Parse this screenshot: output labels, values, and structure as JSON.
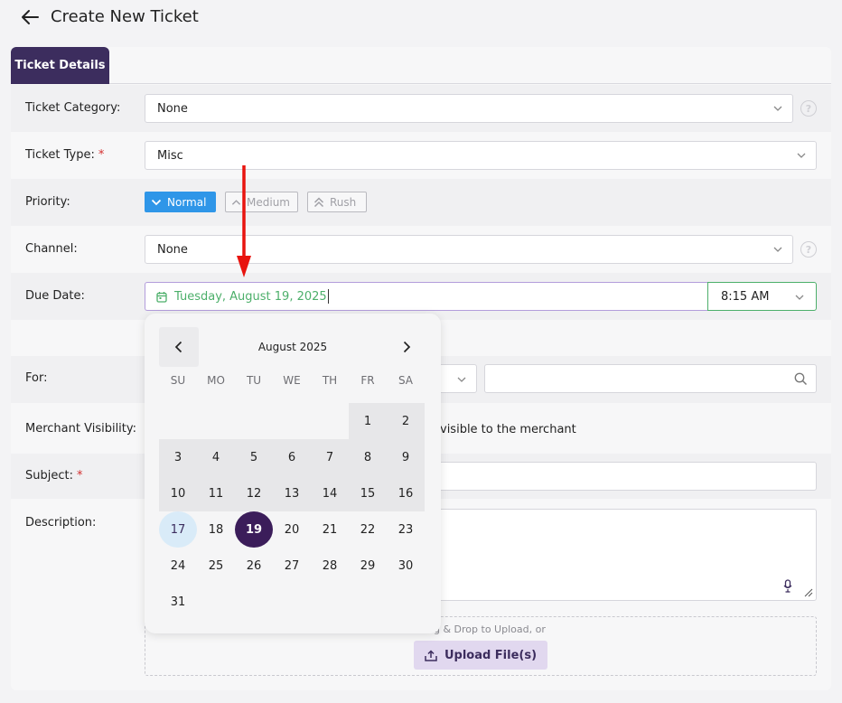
{
  "header": {
    "title": "Create New Ticket"
  },
  "tabs": [
    {
      "label": "Ticket Details"
    }
  ],
  "form": {
    "category": {
      "label": "Ticket Category:",
      "value": "None"
    },
    "type": {
      "label": "Ticket Type:",
      "required": "*",
      "value": "Misc"
    },
    "priority": {
      "label": "Priority:",
      "options": [
        "Normal",
        "Medium",
        "Rush"
      ],
      "selected": "Normal"
    },
    "channel": {
      "label": "Channel:",
      "value": "None"
    },
    "due_date": {
      "label": "Due Date:",
      "value": "Tuesday, August 19, 2025",
      "time": "8:15 AM"
    },
    "for": {
      "label": "For:"
    },
    "merchant_visibility": {
      "label": "Merchant Visibility:",
      "text": "visible to the merchant"
    },
    "subject": {
      "label": "Subject:",
      "required": "*"
    },
    "description": {
      "label": "Description:"
    },
    "upload": {
      "hint": "g & Drop to Upload, or",
      "button": "Upload File(s)"
    }
  },
  "help": "?",
  "calendar": {
    "month": "August 2025",
    "weekdays": [
      "SU",
      "MO",
      "TU",
      "WE",
      "TH",
      "FR",
      "SA"
    ],
    "weeks": [
      [
        "",
        "",
        "",
        "",
        "",
        "1",
        "2"
      ],
      [
        "3",
        "4",
        "5",
        "6",
        "7",
        "8",
        "9"
      ],
      [
        "10",
        "11",
        "12",
        "13",
        "14",
        "15",
        "16"
      ],
      [
        "17",
        "18",
        "19",
        "20",
        "21",
        "22",
        "23"
      ],
      [
        "24",
        "25",
        "26",
        "27",
        "28",
        "29",
        "30"
      ],
      [
        "31",
        "",
        "",
        "",
        "",
        "",
        ""
      ]
    ],
    "today": "17",
    "selected": "19"
  },
  "colors": {
    "brand": "#3c2d5e",
    "accent_blue": "#2f96e8",
    "date_green": "#4caf6a",
    "required_red": "#d32f2f",
    "annotation_red": "#e8140f"
  }
}
